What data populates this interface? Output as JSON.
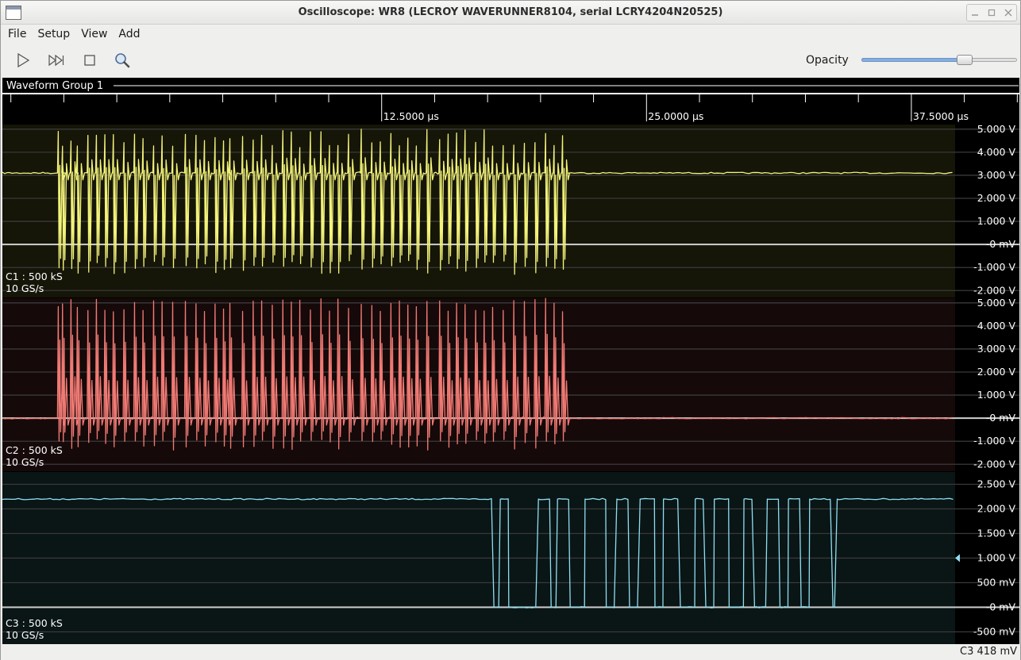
{
  "window": {
    "title": "Oscilloscope: WR8 (LECROY WAVERUNNER8104, serial LCRY4204N20525)"
  },
  "menu": [
    "File",
    "Setup",
    "View",
    "Add"
  ],
  "toolbar": {
    "buttons": [
      "play-icon",
      "step-forward-icon",
      "stop-icon",
      "zoom-icon"
    ],
    "opacity_label": "Opacity",
    "opacity_value": 0.68
  },
  "scope": {
    "group_title": "Waveform Group 1",
    "timebase": {
      "range_us": [
        -5.4,
        42.6
      ],
      "major_labels": [
        {
          "t_us": 12.5,
          "label": "12.5000 µs"
        },
        {
          "t_us": 25.0,
          "label": "25.0000 µs"
        },
        {
          "t_us": 37.5,
          "label": "37.5000 µs"
        }
      ],
      "tick_interval_us": 2.5
    },
    "channels": [
      {
        "name": "C1",
        "info1": "C1 : 500 kS",
        "info2": "10 GS/s",
        "color": "#f2f27a",
        "bg": "#151508",
        "v_range": [
          -2.3,
          5.2
        ],
        "ticks": [
          {
            "v": 5,
            "label": "5.000  V"
          },
          {
            "v": 4,
            "label": "4.000  V"
          },
          {
            "v": 3,
            "label": "3.000  V"
          },
          {
            "v": 2,
            "label": "2.000  V"
          },
          {
            "v": 1,
            "label": "1.000  V"
          },
          {
            "v": 0,
            "label": "-0  mV"
          },
          {
            "v": -1,
            "label": "-1.000  V"
          },
          {
            "v": -2,
            "label": "-2.000  V"
          }
        ],
        "idle_level_v": 3.1
      },
      {
        "name": "C2",
        "info1": "C2 : 500 kS",
        "info2": "10 GS/s",
        "color": "#f07a74",
        "bg": "#160909",
        "v_range": [
          -2.3,
          5.2
        ],
        "ticks": [
          {
            "v": 5,
            "label": "5.000  V"
          },
          {
            "v": 4,
            "label": "4.000  V"
          },
          {
            "v": 3,
            "label": "3.000  V"
          },
          {
            "v": 2,
            "label": "2.000  V"
          },
          {
            "v": 1,
            "label": "1.000  V"
          },
          {
            "v": 0,
            "label": "-0  mV"
          },
          {
            "v": -1,
            "label": "-1.000  V"
          },
          {
            "v": -2,
            "label": "-2.000  V"
          }
        ],
        "idle_level_v": 0.0
      },
      {
        "name": "C3",
        "info1": "C3 : 500 kS",
        "info2": "10 GS/s",
        "color": "#8fdff0",
        "bg": "#0a1516",
        "v_range": [
          -0.75,
          2.75
        ],
        "ticks": [
          {
            "v": 2.5,
            "label": "2.500  V"
          },
          {
            "v": 2.0,
            "label": "2.000  V"
          },
          {
            "v": 1.5,
            "label": "1.500  V"
          },
          {
            "v": 1.0,
            "label": "1.000  V"
          },
          {
            "v": 0.5,
            "label": "500  mV"
          },
          {
            "v": 0.0,
            "label": "-0  mV"
          },
          {
            "v": -0.5,
            "label": "-500  mV"
          }
        ],
        "trigger_level_v": 1.0
      }
    ],
    "burst_times_us": [
      -2.8,
      -2.6,
      -2.2,
      -1.9,
      -1.4,
      -1.0,
      -0.6,
      -0.2,
      0.3,
      0.8,
      1.2,
      1.7,
      2.1,
      2.6,
      3.2,
      3.7,
      4.1,
      4.6,
      5.0,
      5.3,
      5.9,
      6.4,
      6.8,
      7.3,
      7.8,
      8.2,
      8.6,
      9.1,
      9.6,
      10.0,
      10.4,
      10.9,
      11.5,
      12.0,
      12.4,
      12.9,
      13.3,
      13.7,
      14.1,
      14.6,
      15.2,
      15.6,
      16.0,
      16.4,
      16.9,
      17.3,
      17.7,
      18.2,
      18.7,
      19.2,
      19.7,
      20.2,
      20.6,
      21.0
    ],
    "digital_c3": {
      "low_v": 0.0,
      "high_v": 2.2,
      "transitions_us": [
        17.8,
        18.1,
        18.5,
        19.9,
        20.5,
        20.8,
        21.4,
        22.1,
        23.1,
        23.6,
        24.2,
        24.7,
        25.4,
        25.8,
        26.6,
        27.3,
        27.8,
        28.2,
        28.9,
        29.6,
        30.1,
        30.7,
        31.3,
        31.7,
        32.3,
        32.7,
        33.8,
        34.0
      ]
    }
  },
  "status": {
    "text": "C3 418 mV"
  }
}
